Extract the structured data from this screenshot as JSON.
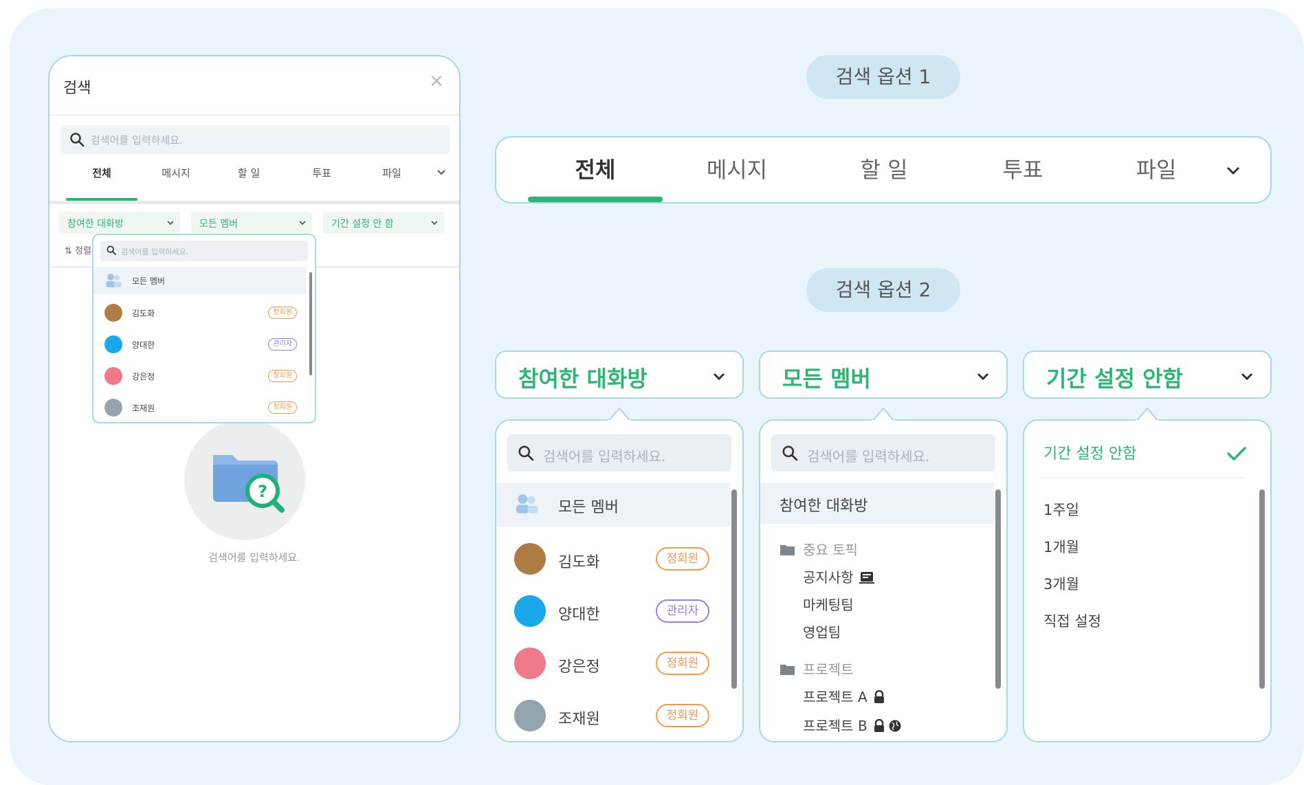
{
  "left_panel": {
    "title": "검색",
    "close_icon": "close-icon",
    "search_placeholder": "검색어를 입력하세요.",
    "tabs": [
      {
        "label": "전체",
        "active": true
      },
      {
        "label": "메시지"
      },
      {
        "label": "할 일"
      },
      {
        "label": "투표"
      },
      {
        "label": "파일"
      }
    ],
    "filters": [
      "참여한 대화방",
      "모든 멤버",
      "기간 설정 안 함"
    ],
    "sort_label": "정렬",
    "empty_text": "검색어를 입력하세요.",
    "dropdown": {
      "search_placeholder": "검색어를 입력하세요.",
      "all_label": "모든 멤버",
      "members": [
        {
          "name": "김도화",
          "badge": "정회원",
          "color": "#b07c45"
        },
        {
          "name": "양대한",
          "badge": "관리자",
          "color": "#1aa7ec"
        },
        {
          "name": "강은정",
          "badge": "정회원",
          "color": "#ef7b8a"
        },
        {
          "name": "조재원",
          "badge": "정회원",
          "color": "#93a4af"
        }
      ]
    }
  },
  "option1": {
    "pill": "검색 옵션 1",
    "tabs": [
      {
        "label": "전체",
        "active": true
      },
      {
        "label": "메시지"
      },
      {
        "label": "할 일"
      },
      {
        "label": "투표"
      },
      {
        "label": "파일"
      }
    ]
  },
  "option2": {
    "pill": "검색 옵션 2",
    "filters": [
      "참여한 대화방",
      "모든 멤버",
      "기간 설정 안함"
    ],
    "members_dropdown": {
      "search_placeholder": "검색어를 입력하세요.",
      "all_label": "모든 멤버",
      "members": [
        {
          "name": "김도화",
          "badge": "정회원",
          "color": "#b07c45"
        },
        {
          "name": "양대한",
          "badge": "관리자",
          "color": "#1aa7ec"
        },
        {
          "name": "강은정",
          "badge": "정회원",
          "color": "#ef7b8a"
        },
        {
          "name": "조재원",
          "badge": "정회원",
          "color": "#93a4af"
        }
      ]
    },
    "rooms_dropdown": {
      "search_placeholder": "검색어를 입력하세요.",
      "all_label": "참여한 대화방",
      "groups": [
        {
          "name": "중요 토픽",
          "rooms": [
            "공지사항",
            "마케팅팀",
            "영업팀"
          ]
        },
        {
          "name": "프로젝트",
          "rooms": [
            "프로젝트 A",
            "프로젝트 B"
          ]
        }
      ]
    },
    "period_dropdown": {
      "selected": "기간 설정 안함",
      "options": [
        "1주일",
        "1개월",
        "3개월",
        "직접 설정"
      ]
    }
  },
  "colors": {
    "accent": "#2bb673",
    "border": "#a8d8e4",
    "badge_member": "#f29a4a",
    "badge_admin": "#9b7be8",
    "background": "#eaf4fb"
  }
}
